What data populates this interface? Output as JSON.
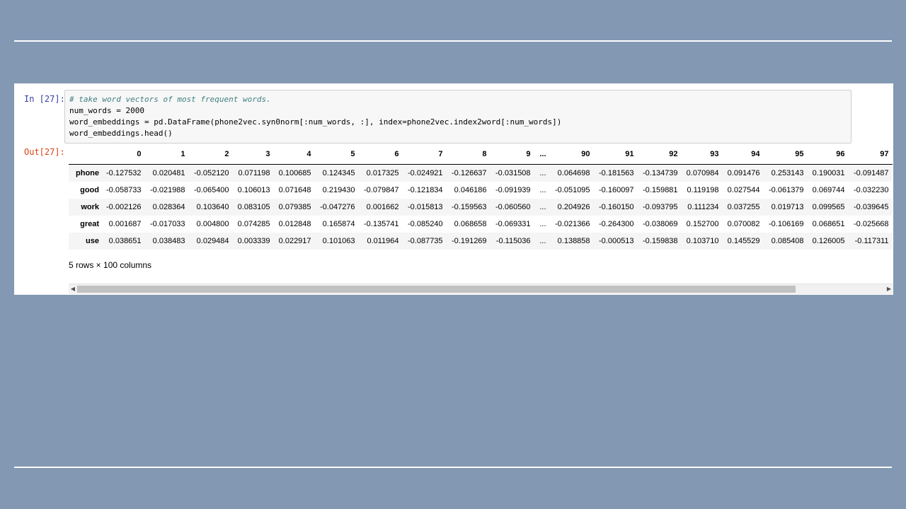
{
  "cell": {
    "in_prompt": "In [27]:",
    "out_prompt": "Out[27]:",
    "code": [
      "# take word vectors of most frequent words.",
      "num_words = 2000",
      "word_embeddings = pd.DataFrame(phone2vec.syn0norm[:num_words, :], index=phone2vec.index2word[:num_words])",
      "word_embeddings.head()"
    ]
  },
  "dataframe": {
    "columns": [
      "0",
      "1",
      "2",
      "3",
      "4",
      "5",
      "6",
      "7",
      "8",
      "9",
      "...",
      "90",
      "91",
      "92",
      "93",
      "94",
      "95",
      "96",
      "97"
    ],
    "rows": [
      {
        "index": "phone",
        "values": [
          "-0.127532",
          "0.020481",
          "-0.052120",
          "0.071198",
          "0.100685",
          "0.124345",
          "0.017325",
          "-0.024921",
          "-0.126637",
          "-0.031508",
          "...",
          "0.064698",
          "-0.181563",
          "-0.134739",
          "0.070984",
          "0.091476",
          "0.253143",
          "0.190031",
          "-0.091487"
        ]
      },
      {
        "index": "good",
        "values": [
          "-0.058733",
          "-0.021988",
          "-0.065400",
          "0.106013",
          "0.071648",
          "0.219430",
          "-0.079847",
          "-0.121834",
          "0.046186",
          "-0.091939",
          "...",
          "-0.051095",
          "-0.160097",
          "-0.159881",
          "0.119198",
          "0.027544",
          "-0.061379",
          "0.069744",
          "-0.032230"
        ]
      },
      {
        "index": "work",
        "values": [
          "-0.002126",
          "0.028364",
          "0.103640",
          "0.083105",
          "0.079385",
          "-0.047276",
          "0.001662",
          "-0.015813",
          "-0.159563",
          "-0.060560",
          "...",
          "0.204926",
          "-0.160150",
          "-0.093795",
          "0.111234",
          "0.037255",
          "0.019713",
          "0.099565",
          "-0.039645"
        ]
      },
      {
        "index": "great",
        "values": [
          "0.001687",
          "-0.017033",
          "0.004800",
          "0.074285",
          "0.012848",
          "0.165874",
          "-0.135741",
          "-0.085240",
          "0.068658",
          "-0.069331",
          "...",
          "-0.021366",
          "-0.264300",
          "-0.038069",
          "0.152700",
          "0.070082",
          "-0.106169",
          "0.068651",
          "-0.025668"
        ]
      },
      {
        "index": "use",
        "values": [
          "0.038651",
          "0.038483",
          "0.029484",
          "0.003339",
          "0.022917",
          "0.101063",
          "0.011964",
          "-0.087735",
          "-0.191269",
          "-0.115036",
          "...",
          "0.138858",
          "-0.000513",
          "-0.159838",
          "0.103710",
          "0.145529",
          "0.085408",
          "0.126005",
          "-0.117311"
        ]
      }
    ],
    "shape_text": "5 rows × 100 columns"
  },
  "scrollbar": {
    "thumb_fraction": 0.89,
    "left_arrow": "◀",
    "right_arrow": "▶"
  }
}
